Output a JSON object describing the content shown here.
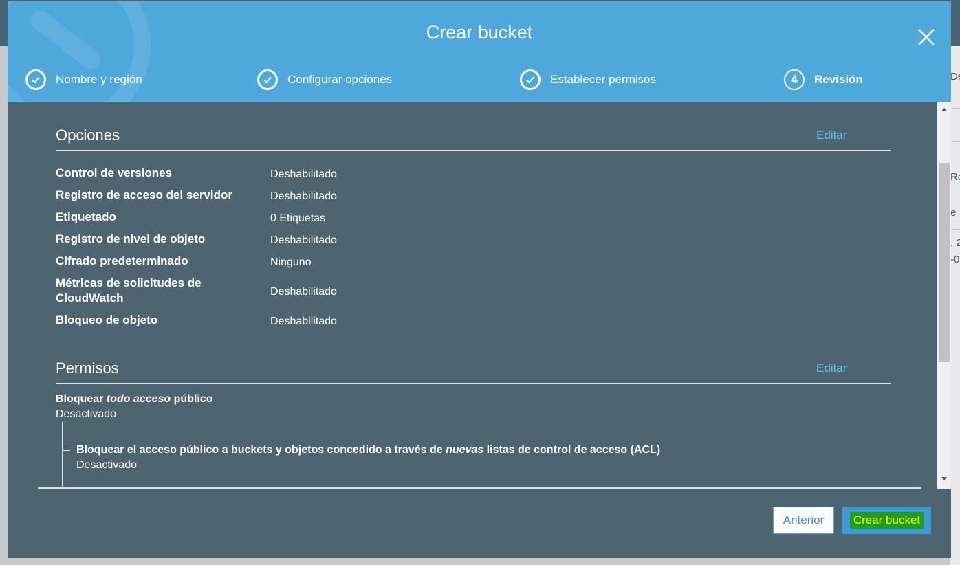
{
  "background": {
    "fragments": [
      "De",
      "Re",
      "e",
      ". 2",
      "-0"
    ]
  },
  "modal": {
    "title": "Crear bucket",
    "close_icon": "close-icon"
  },
  "steps": [
    {
      "label": "Nombre y región",
      "state": "done",
      "icon": "check-circle-icon"
    },
    {
      "label": "Configurar opciones",
      "state": "done",
      "icon": "check-circle-icon"
    },
    {
      "label": "Establecer permisos",
      "state": "done",
      "icon": "check-circle-icon"
    },
    {
      "label": "Revisión",
      "state": "active",
      "number": "4"
    }
  ],
  "options": {
    "title": "Opciones",
    "edit_label": "Editar",
    "rows": [
      {
        "label": "Control de versiones",
        "value": "Deshabilitado"
      },
      {
        "label": "Registro de acceso del servidor",
        "value": "Deshabilitado"
      },
      {
        "label": "Etiquetado",
        "value": "0 Etiquetas"
      },
      {
        "label": "Registro de nivel de objeto",
        "value": "Deshabilitado"
      },
      {
        "label": "Cifrado predeterminado",
        "value": "Ninguno"
      },
      {
        "label": "Métricas de solicitudes de CloudWatch",
        "value": "Deshabilitado"
      },
      {
        "label": "Bloqueo de objeto",
        "value": "Deshabilitado"
      }
    ]
  },
  "permissions": {
    "title": "Permisos",
    "edit_label": "Editar",
    "block_all": {
      "prefix": "Bloquear ",
      "emphasis": "todo acceso",
      "suffix": " público",
      "status": "Desactivado"
    },
    "block_new_acl": {
      "prefix": "Bloquear el acceso público a buckets y objetos concedido a través de ",
      "emphasis": "nuevas",
      "suffix": " listas de control de acceso (ACL)",
      "status": "Desactivado"
    }
  },
  "footer": {
    "prev_label": "Anterior",
    "create_label": "Crear bucket"
  },
  "colors": {
    "header": "#4ea8dc",
    "body": "#4f6471",
    "link": "#5fc3f2",
    "create_highlight_bg": "#1f9d1f",
    "create_highlight_text": "#f5f50a"
  }
}
